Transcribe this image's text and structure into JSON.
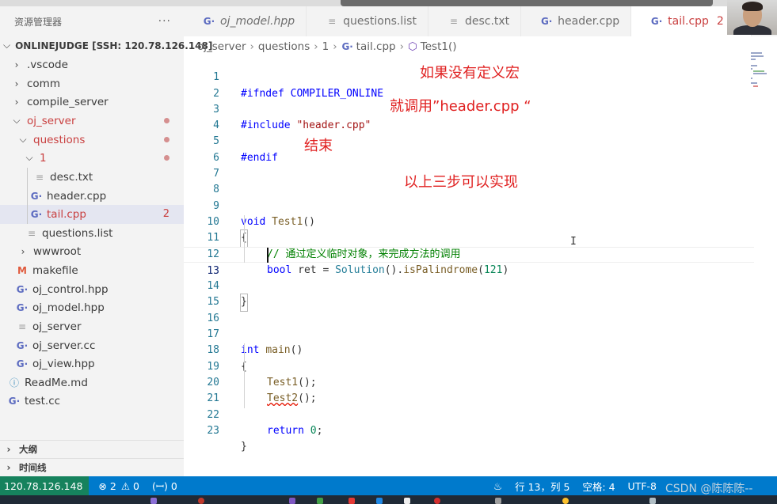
{
  "sidebar": {
    "title": "资源管理器",
    "more": "···",
    "root_label": "ONLINEJUDGE [SSH: 120.78.126.148]",
    "items": [
      {
        "label": ".vscode"
      },
      {
        "label": "comm"
      },
      {
        "label": "compile_server"
      },
      {
        "label": "oj_server"
      },
      {
        "label": "questions"
      },
      {
        "label": "1"
      },
      {
        "label": "desc.txt"
      },
      {
        "label": "header.cpp"
      },
      {
        "label": "tail.cpp",
        "badge": "2"
      },
      {
        "label": "questions.list"
      },
      {
        "label": "wwwroot"
      },
      {
        "label": "makefile"
      },
      {
        "label": "oj_control.hpp"
      },
      {
        "label": "oj_model.hpp"
      },
      {
        "label": "oj_server"
      },
      {
        "label": "oj_server.cc"
      },
      {
        "label": "oj_view.hpp"
      },
      {
        "label": "ReadMe.md"
      },
      {
        "label": "test.cc"
      }
    ],
    "sections": {
      "outline": "大纲",
      "timeline": "时间线"
    }
  },
  "tabs": [
    {
      "label": "oj_model.hpp",
      "icon": "cpp-file-icon"
    },
    {
      "label": "questions.list",
      "icon": "text-file-icon"
    },
    {
      "label": "desc.txt",
      "icon": "text-file-icon"
    },
    {
      "label": "header.cpp",
      "icon": "cpp-file-icon"
    },
    {
      "label": "tail.cpp",
      "icon": "cpp-file-icon",
      "badge": "2"
    }
  ],
  "breadcrumb": {
    "parts": [
      "oj_server",
      "questions",
      "1",
      "tail.cpp",
      "Test1()"
    ]
  },
  "editor": {
    "line_numbers": [
      "1",
      "2",
      "3",
      "4",
      "5",
      "6",
      "7",
      "8",
      "9",
      "10",
      "11",
      "12",
      "13",
      "14",
      "15",
      "16",
      "17",
      "18",
      "19",
      "20",
      "21",
      "22",
      "23"
    ],
    "current_line": 13,
    "tokens": {
      "l1_a": "#ifndef",
      "l1_b": " COMPILER_ONLINE",
      "l3_a": "#include",
      "l3_b": "\"header.cpp\"",
      "l5": "#endif",
      "l9_a": "void",
      "l9_b": "Test1",
      "l9_c": "()",
      "l10": "{",
      "l11": "// 通过定义临时对象，来完成方法的调用",
      "l12_a": "bool",
      "l12_b": " ret = ",
      "l12_c": "Solution",
      "l12_d": "().",
      "l12_e": "isPalindrome",
      "l12_f": "(",
      "l12_g": "121",
      "l12_h": ")",
      "l14": "}",
      "l17_a": "int",
      "l17_b": "main",
      "l17_c": "()",
      "l18": "{",
      "l19_a": "Test1",
      "l19_b": "();",
      "l20_a": "Test2",
      "l20_b": "();",
      "l22_a": "return",
      "l22_b": "0",
      "l22_c": ";",
      "l23": "}"
    }
  },
  "annotations": {
    "a1": "如果没有定义宏",
    "a2": "就调用”header.cpp “",
    "a3": "结束",
    "a4": "以上三步可以实现"
  },
  "statusbar": {
    "remote": "120.78.126.148",
    "errors": "⊗ 2",
    "warnings": "⚠ 0",
    "ports": "(ꟷ) 0",
    "position": "行 13，列 5",
    "spaces": "空格: 4",
    "encoding": "UTF-8"
  },
  "watermark": "CSDN @陈陈陈--",
  "colors": {
    "statusbar": "#007acc",
    "remote": "#16825d",
    "annotation": "#e02020",
    "keyword": "#0000ff",
    "string": "#a31515",
    "comment": "#008000"
  }
}
